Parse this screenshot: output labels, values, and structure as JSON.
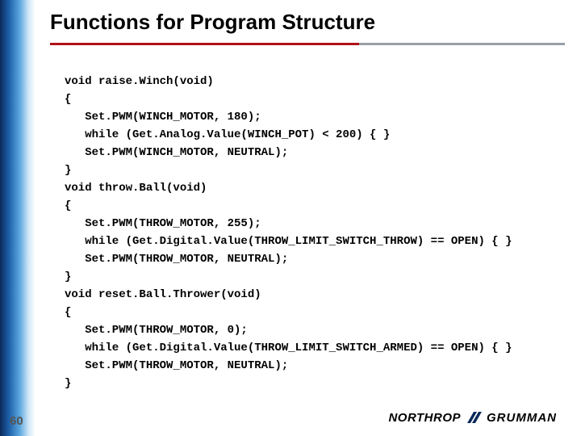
{
  "title": "Functions for Program Structure",
  "page_number": "60",
  "logo": {
    "primary": "NORTHROP",
    "secondary": "GRUMMAN"
  },
  "code_lines": [
    "void raise.Winch(void)",
    "{",
    "   Set.PWM(WINCH_MOTOR, 180);",
    "   while (Get.Analog.Value(WINCH_POT) < 200) { }",
    "   Set.PWM(WINCH_MOTOR, NEUTRAL);",
    "}",
    "void throw.Ball(void)",
    "{",
    "   Set.PWM(THROW_MOTOR, 255);",
    "   while (Get.Digital.Value(THROW_LIMIT_SWITCH_THROW) == OPEN) { }",
    "   Set.PWM(THROW_MOTOR, NEUTRAL);",
    "}",
    "void reset.Ball.Thrower(void)",
    "{",
    "   Set.PWM(THROW_MOTOR, 0);",
    "   while (Get.Digital.Value(THROW_LIMIT_SWITCH_ARMED) == OPEN) { }",
    "   Set.PWM(THROW_MOTOR, NEUTRAL);",
    "}"
  ]
}
